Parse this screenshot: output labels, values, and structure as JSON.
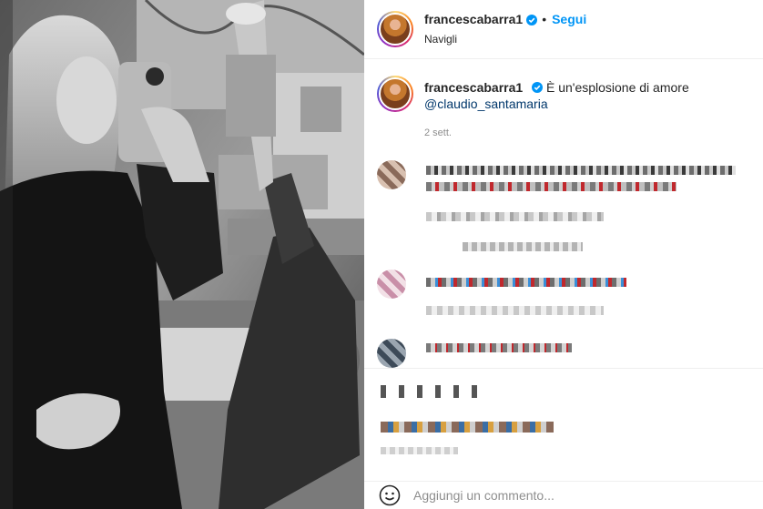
{
  "post": {
    "username": "francescabarra1",
    "dot": "•",
    "follow_label": "Segui",
    "location": "Navigli",
    "caption_text": "È un'esplosione di amore",
    "mention": "@claudio_santamaria",
    "time_ago": "2 sett."
  },
  "comment_box": {
    "placeholder": "Aggiungi un commento..."
  },
  "colors": {
    "accent": "#0095f6",
    "mention": "#00376b",
    "muted": "#8e8e8e"
  },
  "icons": [
    "verified-badge-icon",
    "smile-emoji-icon"
  ]
}
